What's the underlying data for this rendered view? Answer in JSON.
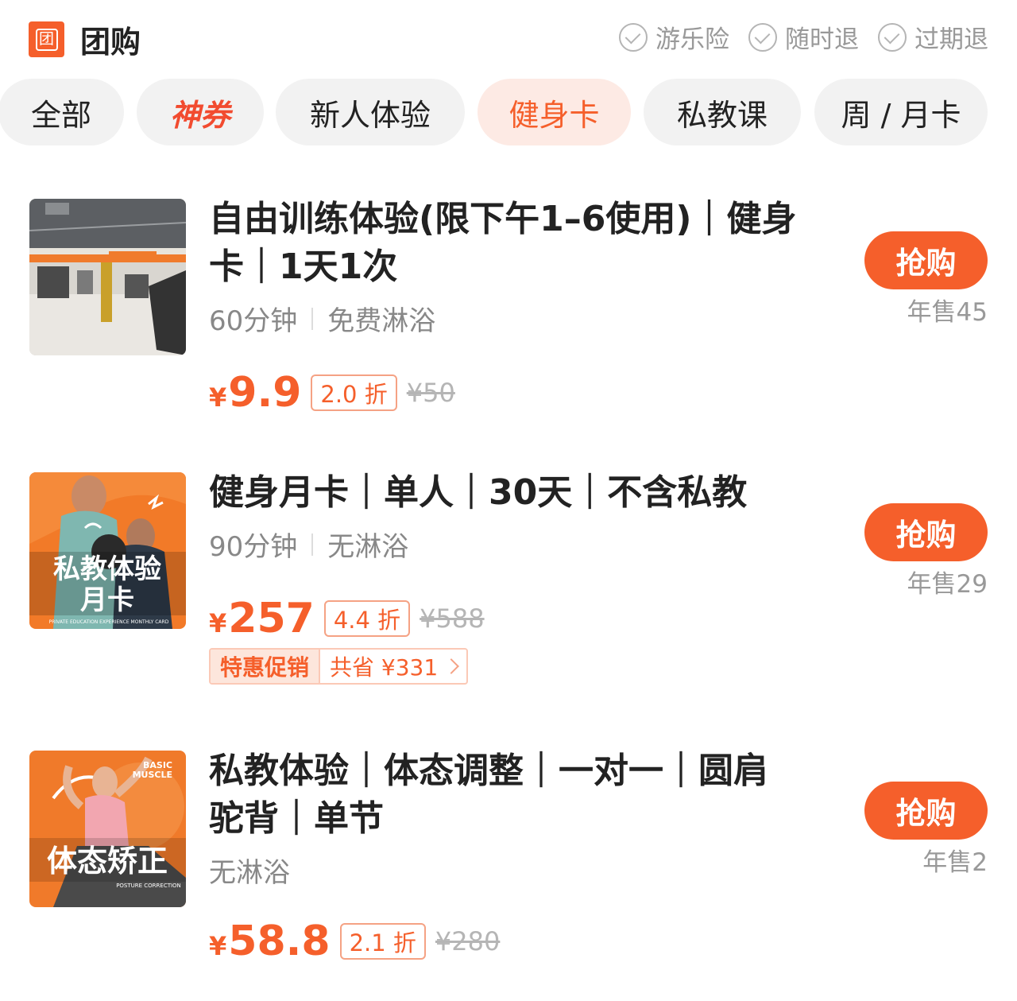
{
  "header": {
    "brand_icon_char": "团",
    "title": "团购",
    "guarantees": [
      "游乐险",
      "随时退",
      "过期退"
    ]
  },
  "tabs": [
    {
      "label": "全部"
    },
    {
      "label": "神券"
    },
    {
      "label": "新人体验"
    },
    {
      "label": "健身卡",
      "active": true
    },
    {
      "label": "私教课"
    },
    {
      "label": "周 / 月卡"
    }
  ],
  "deals": [
    {
      "title_line1": "自由训练体验(限下午1–6使用)｜健身",
      "title_line2": "卡｜1天1次",
      "tags": [
        "60分钟",
        "免费淋浴"
      ],
      "price_symbol": "¥",
      "price": "9.9",
      "discount": "2.0 折",
      "original_price": "¥50",
      "button": "抢购",
      "sold": "年售45"
    },
    {
      "title_line1": "健身月卡｜单人｜30天｜不含私教",
      "tags": [
        "90分钟",
        "无淋浴"
      ],
      "thumb_text_line1": "私教体验",
      "thumb_text_line2": "月卡",
      "thumb_small_text": "PRIVATE EDUCATION EXPERIENCE MONTHLY CARD",
      "price_symbol": "¥",
      "price": "257",
      "discount": "4.4 折",
      "original_price": "¥588",
      "promo_label": "特惠促销",
      "promo_save": "共省 ¥331",
      "button": "抢购",
      "sold": "年售29"
    },
    {
      "title_line1": "私教体验｜体态调整｜一对一｜圆肩",
      "title_line2": "驼背｜单节",
      "tags": [
        "无淋浴"
      ],
      "thumb_text": "体态矫正",
      "thumb_logo_line1": "BASIC",
      "thumb_logo_line2": "MUSCLE",
      "thumb_small_text": "POSTURE CORRECTION",
      "price_symbol": "¥",
      "price": "58.8",
      "discount": "2.1 折",
      "original_price": "¥280",
      "button": "抢购",
      "sold": "年售2"
    }
  ],
  "colors": {
    "accent": "#f55f2b",
    "tab_bg": "#f2f2f2",
    "tab_active_bg": "#fdeae4",
    "muted_text": "#999999"
  }
}
